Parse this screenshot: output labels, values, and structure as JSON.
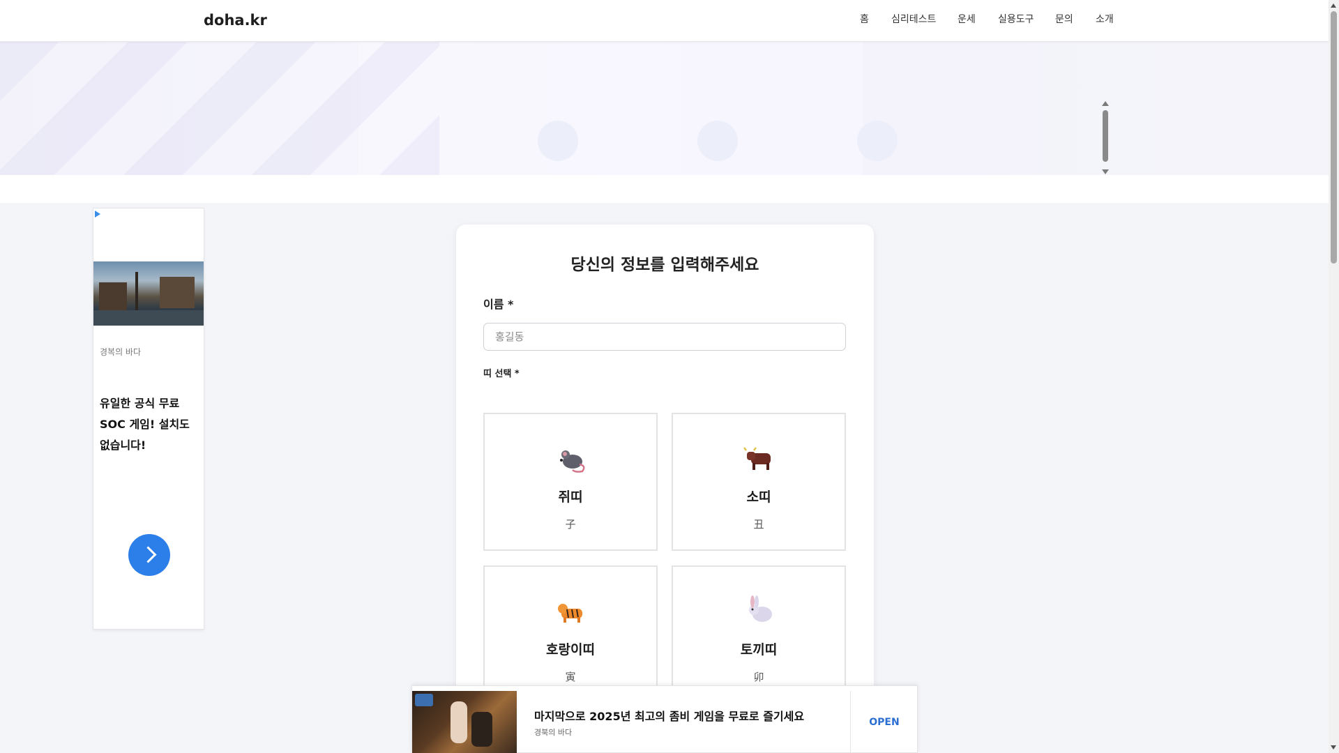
{
  "header": {
    "logo": "doha.kr",
    "nav": [
      "홈",
      "심리테스트",
      "운세",
      "실용도구",
      "문의",
      "소개"
    ]
  },
  "left_ad": {
    "source": "경복의 바다",
    "headline": "유일한 공식 무료 SOC 게임! 설치도 없습니다!",
    "arrow_icon": "chevron-right-icon"
  },
  "form": {
    "title": "당신의 정보를 입력해주세요",
    "name_label": "이름 *",
    "name_placeholder": "홍길동",
    "zodiac_label": "띠 선택 *",
    "zodiacs": [
      {
        "name": "쥐띠",
        "hanja": "子",
        "icon": "rat-icon"
      },
      {
        "name": "소띠",
        "hanja": "丑",
        "icon": "ox-icon"
      },
      {
        "name": "호랑이띠",
        "hanja": "寅",
        "icon": "tiger-icon"
      },
      {
        "name": "토끼띠",
        "hanja": "卯",
        "icon": "rabbit-icon"
      }
    ]
  },
  "bottom_ad": {
    "headline": "마지막으로 2025년 최고의 좀비 게임을 무료로 즐기세요",
    "source": "경북의 바다",
    "cta": "OPEN"
  },
  "colors": {
    "accent": "#2c7fe8",
    "page_bg": "#f4f5f9"
  }
}
